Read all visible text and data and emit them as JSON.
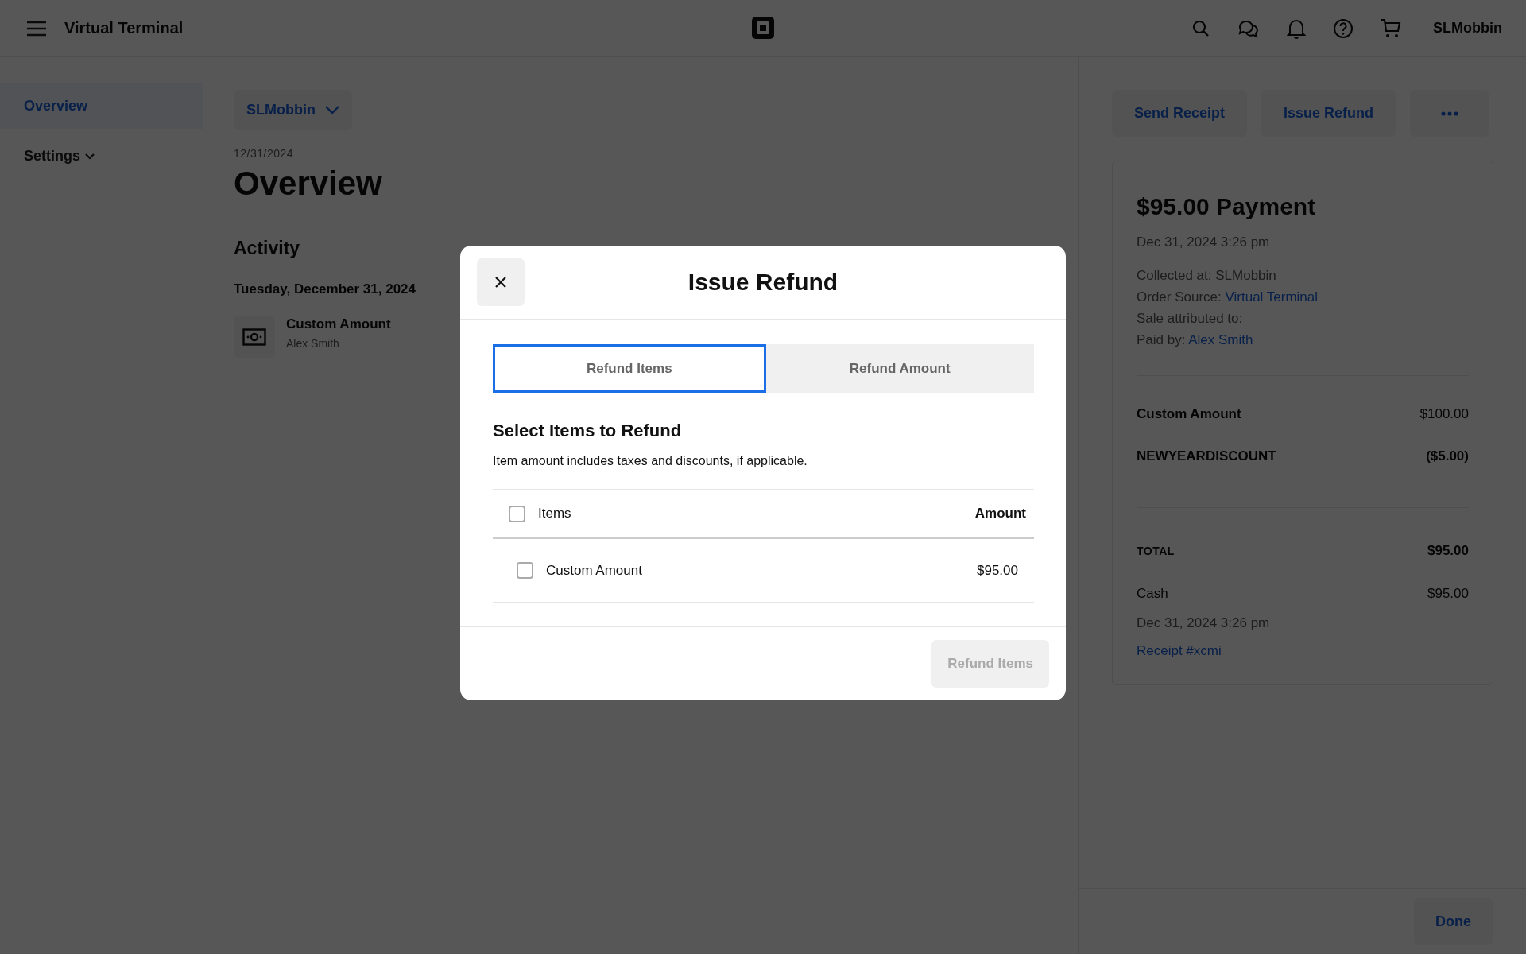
{
  "header": {
    "title": "Virtual Terminal",
    "account": "SLMobbin"
  },
  "sidebar": {
    "items": [
      {
        "label": "Overview",
        "selected": true,
        "kind": "link"
      },
      {
        "label": "Settings",
        "selected": false,
        "kind": "expandable"
      }
    ]
  },
  "main": {
    "location_button": "SLMobbin",
    "date": "12/31/2024",
    "heading": "Overview",
    "section": "Activity",
    "day": "Tuesday, December 31, 2024",
    "activity": [
      {
        "title": "Custom Amount",
        "subtitle": "Alex Smith"
      }
    ]
  },
  "detail": {
    "actions": [
      "Send Receipt",
      "Issue Refund"
    ],
    "title": "$95.00 Payment",
    "date": "Dec 31, 2024 3:26 pm",
    "info": [
      {
        "label": "Collected at: SLMobbin"
      },
      {
        "label": "Order Source:",
        "link": "Virtual Terminal"
      },
      {
        "label": "Sale attributed to:"
      },
      {
        "label": "Paid by:",
        "link": "Alex Smith"
      }
    ],
    "line_items": [
      {
        "kind": "item",
        "label": "Custom Amount",
        "amount": "$100.00"
      },
      {
        "kind": "discount",
        "label": "NEWYEARDISCOUNT",
        "amount": "($5.00)"
      }
    ],
    "total": {
      "label": "TOTAL",
      "amount": "$95.00"
    },
    "tender": {
      "label": "Cash",
      "amount": "$95.00",
      "date": "Dec 31, 2024 3:26 pm",
      "receipt": "Receipt #xcmi"
    },
    "done_button": "Done"
  },
  "modal": {
    "title": "Issue Refund",
    "tabs": [
      {
        "label": "Refund Items",
        "selected": true
      },
      {
        "label": "Refund Amount",
        "selected": false
      }
    ],
    "heading": "Select Items to Refund",
    "description": "Item amount includes taxes and discounts, if applicable.",
    "table": {
      "columns": [
        "Items",
        "Amount"
      ],
      "select_all_checked": false,
      "rows": [
        {
          "item": "Custom Amount",
          "amount": "$95.00",
          "checked": false
        }
      ]
    },
    "submit": {
      "label": "Refund Items",
      "disabled": true
    }
  }
}
